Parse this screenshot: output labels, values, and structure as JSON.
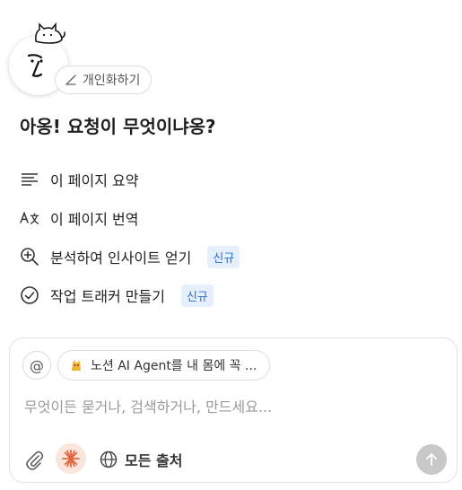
{
  "header": {
    "personalize_label": "개인화하기",
    "avatar_icon": "cat-mascot-icon"
  },
  "greeting": "아옹! 요청이 무엇이냐옹?",
  "actions": [
    {
      "label": "이 페이지 요약",
      "icon": "summary-lines-icon",
      "badge": ""
    },
    {
      "label": "이 페이지 번역",
      "icon": "translate-icon",
      "badge": ""
    },
    {
      "label": "분석하여 인사이트 얻기",
      "icon": "zoom-in-icon",
      "badge": "신규"
    },
    {
      "label": "작업 트래커 만들기",
      "icon": "check-circle-icon",
      "badge": "신규"
    }
  ],
  "composer": {
    "mention_label": "@",
    "context_chip_label": "노션 AI Agent를 내 몸에 꼭 ...",
    "placeholder": "무엇이든 묻거나, 검색하거나, 만드세요...",
    "sources_label": "모든 출처"
  },
  "colors": {
    "badge_text": "#2a6fd6",
    "badge_bg": "#e6f0fc",
    "burst": "#e0663f",
    "burst_bg": "#fbe5dc",
    "send_bg": "#c8c8c8"
  }
}
